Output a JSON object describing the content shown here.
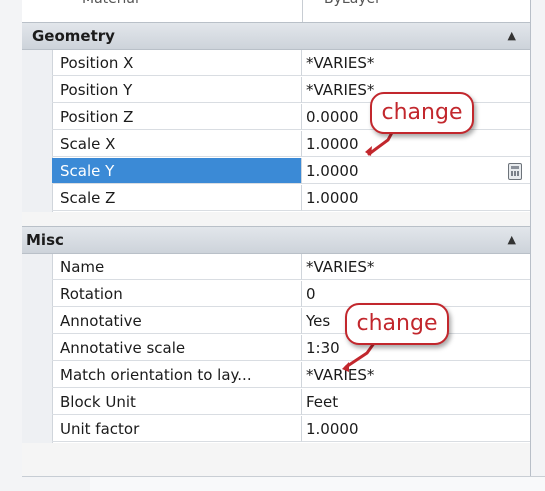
{
  "top_row": {
    "name": "Material",
    "value": "ByLayer"
  },
  "sections": [
    {
      "title": "Geometry",
      "rows": [
        {
          "name": "Position X",
          "value": "*VARIES*"
        },
        {
          "name": "Position Y",
          "value": "*VARIES*"
        },
        {
          "name": "Position Z",
          "value": "0.0000"
        },
        {
          "name": "Scale X",
          "value": "1.0000"
        },
        {
          "name": "Scale Y",
          "value": "1.0000",
          "selected": true
        },
        {
          "name": "Scale Z",
          "value": "1.0000"
        }
      ]
    },
    {
      "title": "Misc",
      "rows": [
        {
          "name": "Name",
          "value": "*VARIES*"
        },
        {
          "name": "Rotation",
          "value": "0"
        },
        {
          "name": "Annotative",
          "value": "Yes"
        },
        {
          "name": "Annotative scale",
          "value": "1:30"
        },
        {
          "name": "Match orientation to lay...",
          "value": "*VARIES*"
        },
        {
          "name": "Block Unit",
          "value": "Feet"
        },
        {
          "name": "Unit factor",
          "value": "1.0000"
        }
      ]
    }
  ],
  "callouts": [
    {
      "text": "change"
    },
    {
      "text": "change"
    }
  ],
  "icons": {
    "collapse": "chevron-up-icon",
    "calculator": "calculator-icon"
  },
  "colors": {
    "selection": "#3b8ad6",
    "callout": "#c2272d"
  }
}
